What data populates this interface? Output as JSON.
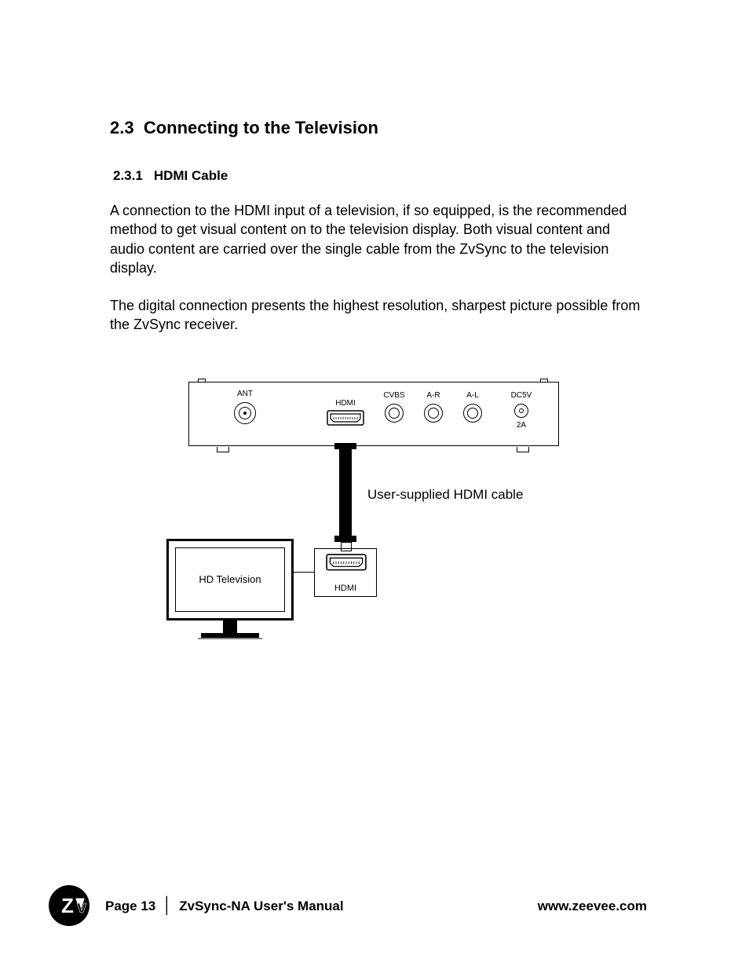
{
  "section": {
    "number": "2.3",
    "title": "Connecting to the Television"
  },
  "subsection": {
    "number": "2.3.1",
    "title": "HDMI Cable"
  },
  "paragraphs": [
    "A connection to the HDMI input of a television, if so equipped, is the recommended method to get visual content on to the television display.  Both visual content and audio content are carried over the single cable from the ZvSync to the television display.",
    "The digital connection presents the highest resolution, sharpest picture possible from the ZvSync receiver."
  ],
  "diagram": {
    "ports": {
      "ant": "ANT",
      "hdmi": "HDMI",
      "cvbs": "CVBS",
      "ar": "A-R",
      "al": "A-L",
      "dc5v": "DC5V",
      "dc_amp": "2A"
    },
    "cable_caption": "User-supplied HDMI cable",
    "tv_label": "HD Television",
    "tv_port_label": "HDMI"
  },
  "footer": {
    "page": "Page 13",
    "manual": "ZvSync-NA User's Manual",
    "url": "www.zeevee.com"
  }
}
